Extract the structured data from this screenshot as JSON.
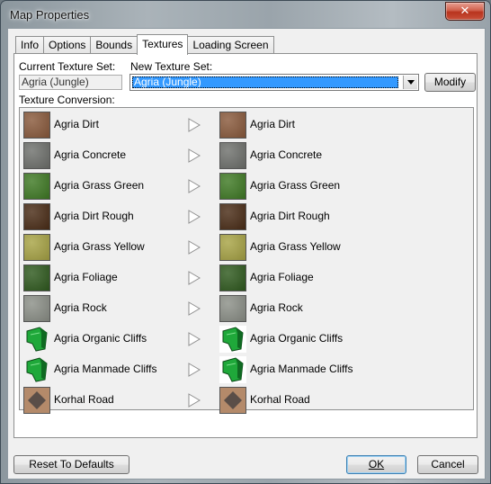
{
  "window": {
    "title": "Map Properties",
    "close_symbol": "✕"
  },
  "tabs": [
    {
      "label": "Info",
      "active": false
    },
    {
      "label": "Options",
      "active": false
    },
    {
      "label": "Bounds",
      "active": false
    },
    {
      "label": "Textures",
      "active": true
    },
    {
      "label": "Loading Screen",
      "active": false
    }
  ],
  "current_set": {
    "label": "Current Texture Set:",
    "value": "Agria (Jungle)"
  },
  "new_set": {
    "label": "New Texture Set:",
    "value": "Agria (Jungle)"
  },
  "modify_label": "Modify",
  "conversion_label": "Texture Conversion:",
  "textures": [
    {
      "from": "Agria Dirt",
      "to": "Agria Dirt",
      "icon": "dirt-texture-icon",
      "color": "#8a5a3c"
    },
    {
      "from": "Agria Concrete",
      "to": "Agria Concrete",
      "icon": "concrete-texture-icon",
      "color": "#6f716d"
    },
    {
      "from": "Agria Grass Green",
      "to": "Agria Grass Green",
      "icon": "grass-green-texture-icon",
      "color": "#3f7a24"
    },
    {
      "from": "Agria Dirt Rough",
      "to": "Agria Dirt Rough",
      "icon": "dirt-rough-texture-icon",
      "color": "#4a2c16"
    },
    {
      "from": "Agria Grass Yellow",
      "to": "Agria Grass Yellow",
      "icon": "grass-yellow-texture-icon",
      "color": "#a8a445"
    },
    {
      "from": "Agria Foliage",
      "to": "Agria Foliage",
      "icon": "foliage-texture-icon",
      "color": "#2f5a1e"
    },
    {
      "from": "Agria Rock",
      "to": "Agria Rock",
      "icon": "rock-texture-icon",
      "color": "#8c9088"
    },
    {
      "from": "Agria Organic Cliffs",
      "to": "Agria Organic Cliffs",
      "icon": "organic-cliff-icon",
      "color": "#1fa83a"
    },
    {
      "from": "Agria Manmade Cliffs",
      "to": "Agria Manmade Cliffs",
      "icon": "manmade-cliff-icon",
      "color": "#1fa83a"
    },
    {
      "from": "Korhal Road",
      "to": "Korhal Road",
      "icon": "road-texture-icon",
      "color": "#5a4e48"
    }
  ],
  "footer": {
    "reset": "Reset To Defaults",
    "ok": "OK",
    "cancel": "Cancel"
  }
}
